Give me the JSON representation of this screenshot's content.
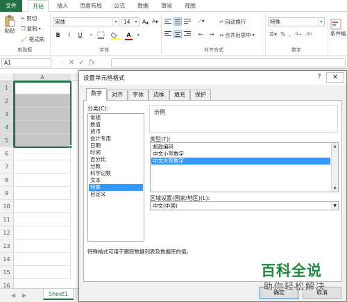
{
  "ribbon_tabs": [
    "文件",
    "开始",
    "插入",
    "页面布局",
    "公式",
    "数据",
    "审阅",
    "视图"
  ],
  "clipboard": {
    "paste": "粘贴",
    "cut": "剪切",
    "copy": "复制",
    "format_painter": "格式刷",
    "group": "剪贴板"
  },
  "font": {
    "name": "宋体",
    "size": "14",
    "bold": "B",
    "italic": "I",
    "underline": "U",
    "fill_color_letter": "A",
    "group": "字体"
  },
  "alignment": {
    "wrap_text": "自动换行",
    "merge_center": "合并后居中",
    "group": "对齐方式"
  },
  "number": {
    "format": "特殊",
    "group": "数字"
  },
  "styles": {
    "conditional_format": "条件格"
  },
  "formula_bar": {
    "namebox": "A1",
    "fx": "fx"
  },
  "grid": {
    "column_a": "A",
    "rows": [
      "1",
      "2",
      "3",
      "4",
      "5",
      "6",
      "7",
      "8",
      "9",
      "10",
      "11",
      "12",
      "13",
      "14",
      "15",
      "16"
    ]
  },
  "sheet": {
    "tab": "Sheet1"
  },
  "dialog": {
    "title": "设置单元格格式",
    "tabs": [
      "数字",
      "对齐",
      "字体",
      "边框",
      "填充",
      "保护"
    ],
    "active_tab": "数字",
    "category_label": "分类(C):",
    "categories": [
      "常规",
      "数值",
      "货币",
      "会计专用",
      "日期",
      "时间",
      "百分比",
      "分数",
      "科学记数",
      "文本",
      "特殊",
      "自定义"
    ],
    "selected_category": "特殊",
    "sample_label": "示例",
    "type_label": "类型(T):",
    "types": [
      "邮政编码",
      "中文小写数字",
      "中文大写数字"
    ],
    "selected_type": "中文大写数字",
    "locale_label": "区域设置(国家/地区)(L):",
    "locale_value": "中文(中国)",
    "description": "特殊格式可用于跟踪数据列表及数据库的值。",
    "ok": "确定",
    "cancel": "取消",
    "help": "?",
    "close": "✕"
  },
  "watermark": {
    "main": "百科全说",
    "sub": "助你轻松解决"
  },
  "colors": {
    "excel_green": "#217346",
    "selection_blue": "#3399ff",
    "selected_cell_gray": "#c6c6c6"
  }
}
